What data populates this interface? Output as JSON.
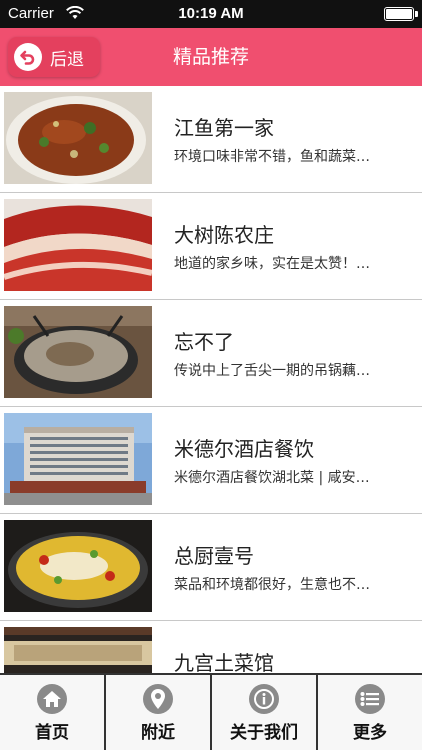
{
  "status_bar": {
    "carrier": "Carrier",
    "time": "10:19 AM",
    "battery_level": 1.0
  },
  "nav": {
    "back_label": "后退",
    "title": "精品推荐",
    "accent_color": "#f04f6f"
  },
  "items": [
    {
      "title": "江鱼第一家",
      "desc": "环境口味非常不错，鱼和蔬菜…",
      "image": "braised-fish-photo"
    },
    {
      "title": "大树陈农庄",
      "desc": "地道的家乡味，实在是太赞！…",
      "image": "cured-meat-photo"
    },
    {
      "title": "忘不了",
      "desc": "传说中上了舌尖一期的吊锅藕…",
      "image": "hot-pot-photo"
    },
    {
      "title": "米德尔酒店餐饮",
      "desc": "米德尔酒店餐饮湖北菜 | 咸安…",
      "image": "hotel-building-photo"
    },
    {
      "title": "总厨壹号",
      "desc": "菜品和环境都很好，生意也不…",
      "image": "fish-stew-photo"
    },
    {
      "title": "九宫土菜馆",
      "desc": "",
      "image": "restaurant-sign-photo"
    }
  ],
  "tabs": [
    {
      "label": "首页",
      "icon": "home-icon"
    },
    {
      "label": "附近",
      "icon": "location-pin-icon"
    },
    {
      "label": "关于我们",
      "icon": "info-icon"
    },
    {
      "label": "更多",
      "icon": "list-icon"
    }
  ]
}
